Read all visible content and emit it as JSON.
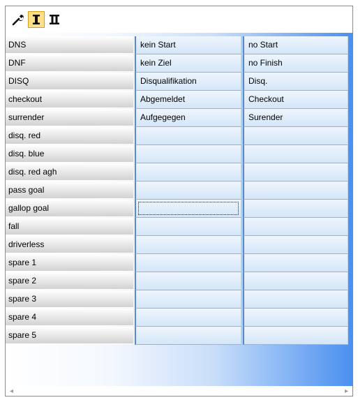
{
  "toolbar": {
    "buttons": [
      {
        "icon": "wrench-icon"
      },
      {
        "icon": "roman-one-icon",
        "label": "I",
        "active": true
      },
      {
        "icon": "roman-two-icon",
        "label": "II"
      }
    ]
  },
  "rows": [
    {
      "code": "DNS",
      "lang1": "kein Start",
      "lang2": "no Start"
    },
    {
      "code": "DNF",
      "lang1": "kein Ziel",
      "lang2": "no Finish"
    },
    {
      "code": "DISQ",
      "lang1": "Disqualifikation",
      "lang2": "Disq."
    },
    {
      "code": "checkout",
      "lang1": "Abgemeldet",
      "lang2": "Checkout"
    },
    {
      "code": "surrender",
      "lang1": "Aufgegegen",
      "lang2": "Surender"
    },
    {
      "code": "disq. red",
      "lang1": "",
      "lang2": ""
    },
    {
      "code": "disq. blue",
      "lang1": "",
      "lang2": ""
    },
    {
      "code": "disq. red agh",
      "lang1": "",
      "lang2": ""
    },
    {
      "code": "pass goal",
      "lang1": "",
      "lang2": ""
    },
    {
      "code": "gallop goal",
      "lang1": "",
      "lang2": ""
    },
    {
      "code": "fall",
      "lang1": "",
      "lang2": ""
    },
    {
      "code": "driverless",
      "lang1": "",
      "lang2": ""
    },
    {
      "code": "spare 1",
      "lang1": "",
      "lang2": ""
    },
    {
      "code": "spare 2",
      "lang1": "",
      "lang2": ""
    },
    {
      "code": "spare 3",
      "lang1": "",
      "lang2": ""
    },
    {
      "code": "spare 4",
      "lang1": "",
      "lang2": ""
    },
    {
      "code": "spare 5",
      "lang1": "",
      "lang2": ""
    }
  ],
  "focused_row": 9,
  "scrollbar": {
    "left_arrow": "◂",
    "right_arrow": "▸"
  },
  "colors": {
    "active_button": "#ffe08a",
    "cell_fill": "#d5e6f8",
    "accent_blue": "#4a90f0"
  }
}
